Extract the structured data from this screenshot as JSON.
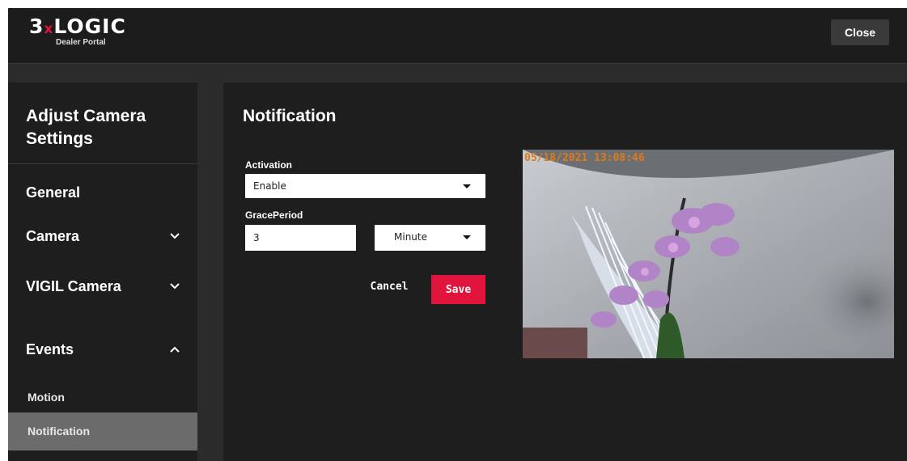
{
  "header": {
    "logo_main": "3",
    "logo_x": "x",
    "logo_rest": "LOGIC",
    "logo_sub": "Dealer Portal",
    "close_label": "Close"
  },
  "sidebar": {
    "title": "Adjust Camera Settings",
    "items": [
      {
        "label": "General"
      },
      {
        "label": "Camera",
        "chevron": "chevron-down"
      },
      {
        "label": "VIGIL Camera",
        "chevron": "chevron-down"
      },
      {
        "label": "Events",
        "chevron": "chevron-up"
      }
    ],
    "sub_items": [
      {
        "label": "Motion"
      },
      {
        "label": "Notification",
        "active": true
      }
    ]
  },
  "main": {
    "title": "Notification",
    "activation_label": "Activation",
    "activation_value": "Enable",
    "grace_label": "GracePeriod",
    "grace_value": "3",
    "grace_unit": "Minute",
    "cancel_label": "Cancel",
    "save_label": "Save",
    "preview_timestamp": "05/18/2021 13:08:46"
  },
  "colors": {
    "accent": "#e0143c",
    "background": "#2b2b2b",
    "panel": "#1e1e1e",
    "active_item": "#6b6b6b",
    "timestamp": "#e07a14"
  }
}
